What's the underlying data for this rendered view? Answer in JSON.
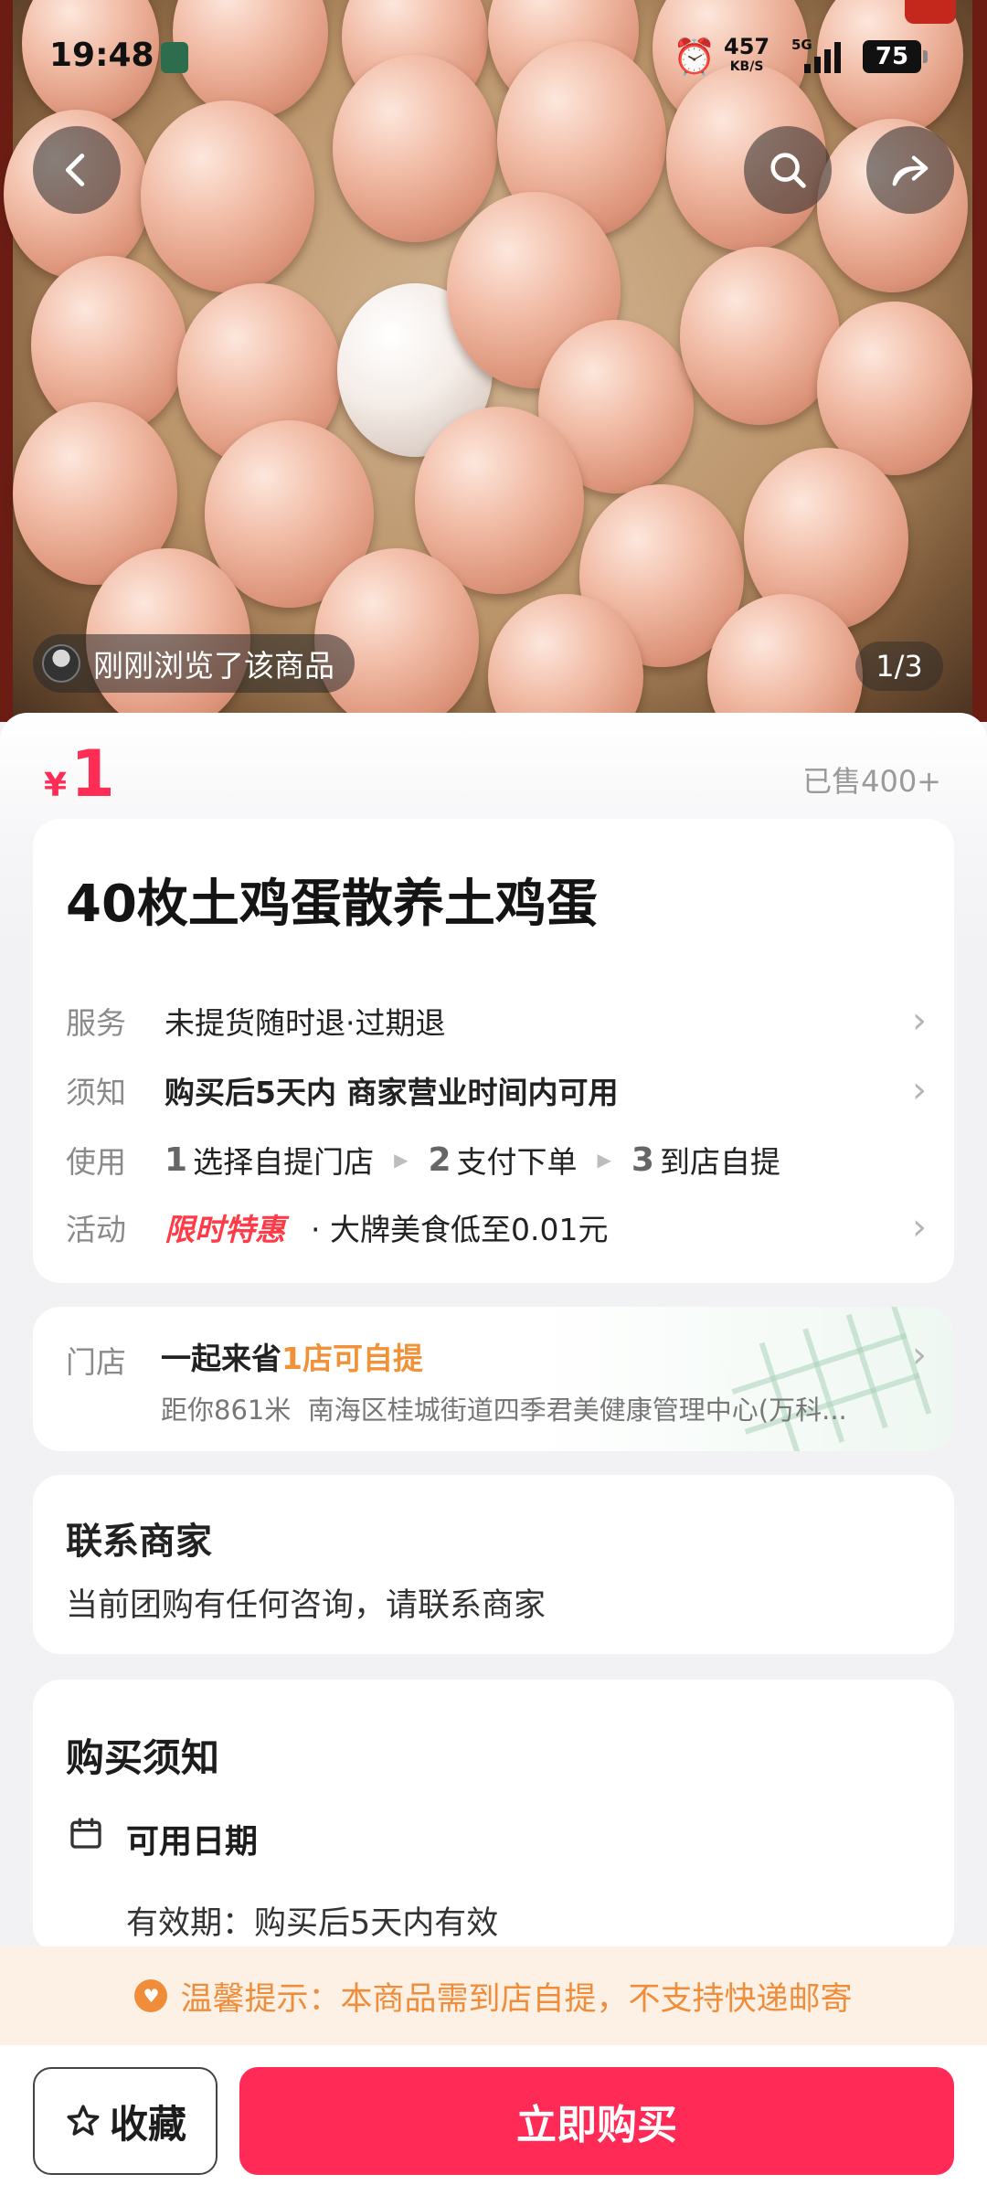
{
  "status_bar": {
    "time": "19:48",
    "net_speed": "457",
    "net_speed_unit": "KB/S",
    "network": "5G",
    "battery": "75"
  },
  "gallery": {
    "viewed_text": "刚刚浏览了该商品",
    "pager": "1/3"
  },
  "product": {
    "currency": "¥",
    "price": "1",
    "sold": "已售400+",
    "title": "40枚土鸡蛋散养土鸡蛋"
  },
  "info_rows": {
    "service": {
      "label": "服务",
      "value": "未提货随时退·过期退"
    },
    "notice": {
      "label": "须知",
      "value": "购买后5天内 商家营业时间内可用"
    },
    "usage": {
      "label": "使用",
      "steps": [
        {
          "num": "1",
          "text": "选择自提门店"
        },
        {
          "num": "2",
          "text": "支付下单"
        },
        {
          "num": "3",
          "text": "到店自提"
        }
      ]
    },
    "activity": {
      "label": "活动",
      "badge": "限时特惠",
      "value": "· 大牌美食低至0.01元"
    }
  },
  "store": {
    "label": "门店",
    "name": "一起来省",
    "count": "1店可自提",
    "distance": "距你861米",
    "address": "南海区桂城街道四季君美健康管理中心(万科..."
  },
  "contact": {
    "title": "联系商家",
    "text": "当前团购有任何咨询，请联系商家"
  },
  "purchase_notes": {
    "title": "购买须知",
    "date_title": "可用日期",
    "validity": "有效期：购买后5天内有效"
  },
  "tip": {
    "text": "温馨提示：本商品需到店自提，不支持快递邮寄"
  },
  "actions": {
    "favorite": "收藏",
    "buy": "立即购买"
  },
  "colors": {
    "accent": "#ff2a55",
    "orange": "#f29238",
    "tip_bg": "#fdf1e6"
  }
}
